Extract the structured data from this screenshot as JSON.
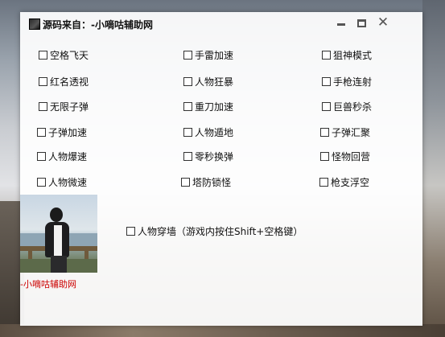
{
  "window": {
    "title": "源码来自：-小嘀咕辅助网"
  },
  "options": [
    {
      "label": "空格飞天"
    },
    {
      "label": "手雷加速"
    },
    {
      "label": "狙神模式"
    },
    {
      "label": "红名透视"
    },
    {
      "label": "人物狂暴"
    },
    {
      "label": "手枪连射"
    },
    {
      "label": "无限子弹"
    },
    {
      "label": "重刀加速"
    },
    {
      "label": "巨兽秒杀"
    },
    {
      "label": "子弹加速"
    },
    {
      "label": "人物遁地"
    },
    {
      "label": "子弹汇聚"
    },
    {
      "label": "人物爆速"
    },
    {
      "label": "零秒换弹"
    },
    {
      "label": "怪物回营"
    },
    {
      "label": "人物微速"
    },
    {
      "label": "塔防锁怪"
    },
    {
      "label": "枪支浮空"
    },
    {
      "label": "人物穿墙（游戏内按住Shift+空格键）"
    }
  ],
  "avatar_caption": "-小嘀咕辅助网",
  "colors": {
    "caption": "#cc0000",
    "window_bg": "#ffffff"
  }
}
